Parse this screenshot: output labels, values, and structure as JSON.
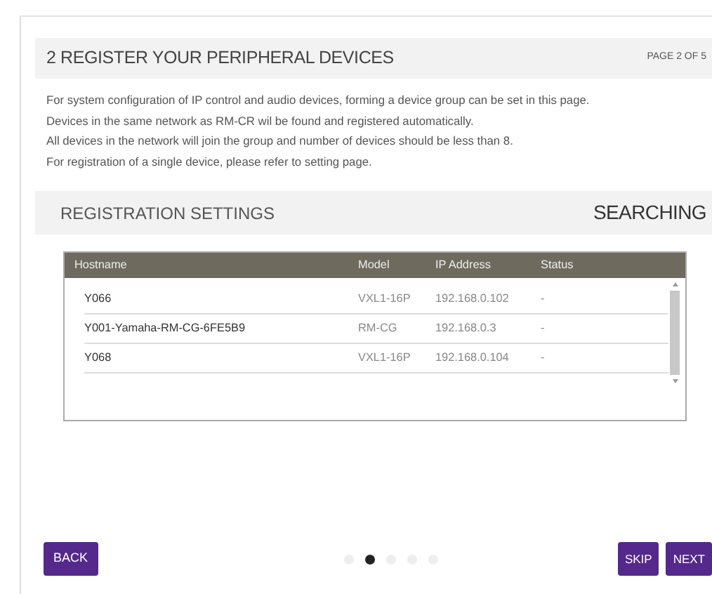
{
  "header": {
    "title": "2 REGISTER YOUR PERIPHERAL DEVICES",
    "page": "PAGE 2 OF 5"
  },
  "description": [
    "For system configuration of IP control and audio devices, forming a device group can be set in this page.",
    "Devices in the same network as RM-CR wil be found and registered automatically.",
    "All devices in the network will join the group and number of devices should be less than 8.",
    "For registration of a single device, please refer to setting page."
  ],
  "section": {
    "title": "REGISTRATION SETTINGS",
    "status": "SEARCHING"
  },
  "table": {
    "columns": [
      "Hostname",
      "Model",
      "IP Address",
      "Status"
    ],
    "rows": [
      [
        "Y066",
        "VXL1-16P",
        "192.168.0.102",
        "-"
      ],
      [
        "Y001-Yamaha-RM-CG-6FE5B9",
        "RM-CG",
        "192.168.0.3",
        "-"
      ],
      [
        "Y068",
        "VXL1-16P",
        "192.168.0.104",
        "-"
      ]
    ]
  },
  "pager": [
    {
      "selected": false
    },
    {
      "selected": true
    },
    {
      "selected": false
    },
    {
      "selected": false
    },
    {
      "selected": false
    }
  ],
  "buttons": {
    "back": "BACK",
    "skip": "SKIP",
    "next": "NEXT"
  }
}
